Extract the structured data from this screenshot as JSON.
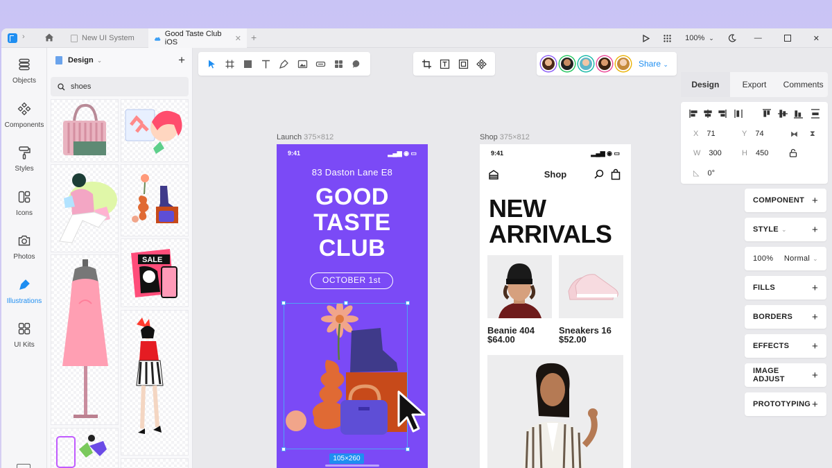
{
  "titlebar": {
    "tabs": [
      {
        "label": "New UI System",
        "active": false
      },
      {
        "label": "Good Taste Club iOS",
        "active": true
      }
    ],
    "zoom": "100%"
  },
  "rail": {
    "items": [
      {
        "label": "Objects",
        "icon": "layers-icon"
      },
      {
        "label": "Components",
        "icon": "components-icon"
      },
      {
        "label": "Styles",
        "icon": "paint-roller-icon"
      },
      {
        "label": "Icons",
        "icon": "icons-icon"
      },
      {
        "label": "Photos",
        "icon": "camera-icon"
      },
      {
        "label": "Illustrations",
        "icon": "pen-icon",
        "active": true
      },
      {
        "label": "UI Kits",
        "icon": "grid-icon"
      }
    ]
  },
  "library": {
    "title": "Design",
    "search_value": "shoes"
  },
  "canvas": {
    "share_label": "Share",
    "frame1": {
      "name": "Launch",
      "size": "375×812",
      "time": "9:41",
      "address": "83 Daston Lane E8",
      "title_lines": [
        "GOOD",
        "TASTE",
        "CLUB"
      ],
      "date_pill": "OCTOBER 1st",
      "selection_size": "105×260"
    },
    "frame2": {
      "name": "Shop",
      "size": "375×812",
      "time": "9:41",
      "nav_title": "Shop",
      "heading_lines": [
        "NEW",
        "ARRIVALS"
      ],
      "products": [
        {
          "name": "Beanie 404",
          "price": "$64.00"
        },
        {
          "name": "Sneakers 16",
          "price": "$52.00"
        }
      ]
    }
  },
  "panel": {
    "tabs": [
      "Design",
      "Export",
      "Comments"
    ],
    "x": "71",
    "y": "74",
    "w": "300",
    "h": "450",
    "rotation": "0°",
    "sections": [
      "COMPONENT",
      "STYLE",
      "FILLS",
      "BORDERS",
      "EFFECTS",
      "IMAGE ADJUST",
      "PROTOTYPING"
    ],
    "opacity": "100%",
    "blend": "Normal"
  },
  "colors": {
    "accent": "#1f8ef1",
    "launch_bg": "#7b4af6"
  }
}
